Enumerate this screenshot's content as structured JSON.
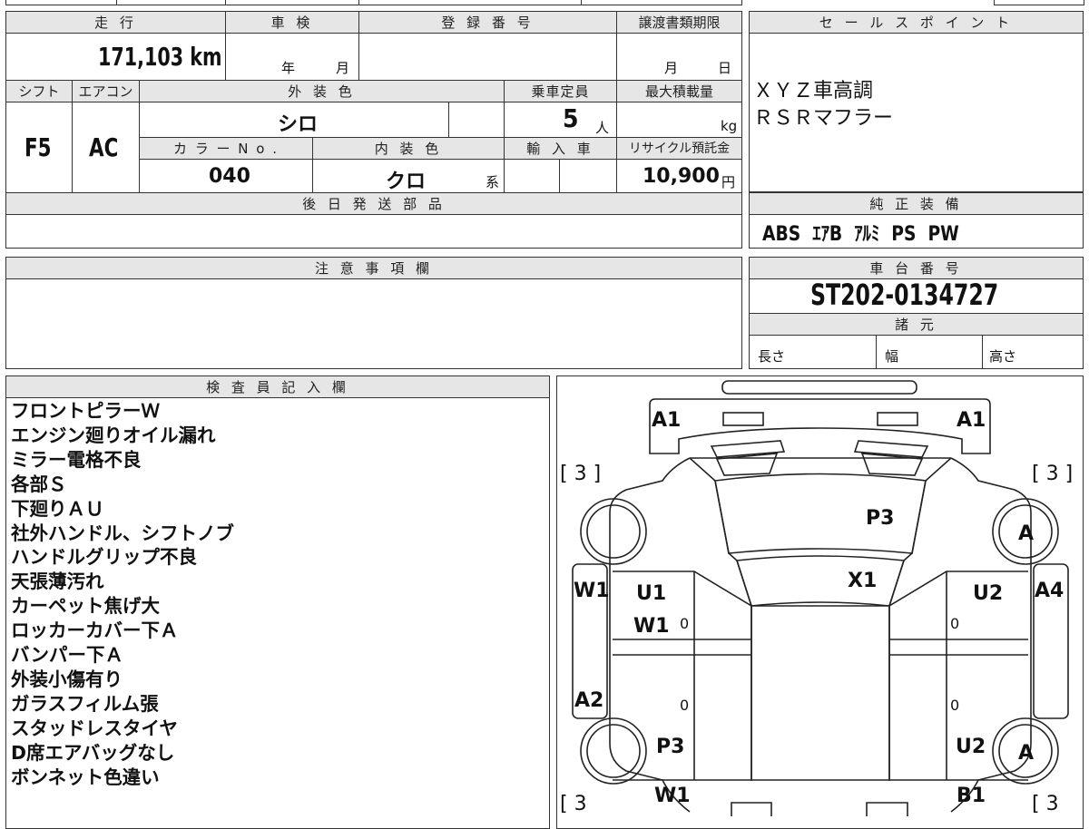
{
  "vehicle": {
    "mileage_label": "走 行",
    "mileage": "171,103 km",
    "inspection_label": "車 検",
    "inspection_year_unit": "年",
    "inspection_month_unit": "月",
    "registration_label": "登 録 番 号",
    "registration_value": "",
    "transfer_deadline_label": "譲渡書類期限",
    "transfer_month_unit": "月",
    "transfer_day_unit": "日",
    "shift_label": "シフト",
    "shift": "F5",
    "aircon_label": "エアコン",
    "aircon": "AC",
    "exterior_color_label": "外 装 色",
    "exterior_color": "シロ",
    "capacity_label": "乗車定員",
    "capacity": "5",
    "capacity_unit": "人",
    "max_load_label": "最大積載量",
    "max_load_unit": "kg",
    "color_no_label": "カ ラ ー N o .",
    "color_no": "040",
    "interior_color_label": "内 装 色",
    "interior_color": "クロ",
    "interior_color_suffix": "系",
    "import_label": "輸 入 車",
    "recycle_label": "リサイクル預託金",
    "recycle_fee": "10,900",
    "recycle_unit": "円",
    "later_parts_label": "後 日 発 送 部 品"
  },
  "sales_points": {
    "label": "セ ー ル ス ポ イ ン ト",
    "items": [
      "ＸＹＺ車高調",
      "ＲＳＲマフラー"
    ]
  },
  "standard_equipment": {
    "label": "純 正 装 備",
    "value": "ABS  ｴｱB  ｱﾙﾐ  PS  PW"
  },
  "caution": {
    "label": "注 意 事 項 欄"
  },
  "chassis": {
    "label": "車 台 番 号",
    "number": "ST202-0134727",
    "specs_label": "諸 元",
    "length_label": "長さ",
    "width_label": "幅",
    "height_label": "高さ"
  },
  "inspector_notes": {
    "label": "検 査 員 記 入 欄",
    "lines": [
      "フロントピラーＷ",
      "エンジン廻りオイル漏れ",
      "ミラー電格不良",
      "各部Ｓ",
      "下廻りＡＵ",
      "社外ハンドル、シフトノブ",
      "ハンドルグリップ不良",
      "天張薄汚れ",
      "カーペット焦げ大",
      "ロッカーカバー下Ａ",
      "バンパー下Ａ",
      "外装小傷有り",
      "ガラスフィルム張",
      "スタッドレスタイヤ",
      "D席エアバッグなし",
      "ボンネット色違い"
    ]
  },
  "diagram": {
    "a1_left": "A1",
    "a1_right": "A1",
    "tire_fl": "[ 3 ]",
    "tire_fr": "[ 3 ]",
    "tire_rl": "[ 3",
    "tire_rr": "[ 3",
    "p3_hood": "P3",
    "a_front_right": "A",
    "x1_windshield": "X1",
    "w1_left_pillar": "W1",
    "u1_front_left": "U1",
    "w1_front_left": "W1",
    "u2_front_right": "U2",
    "a4_right": "A4",
    "zero_1": "0",
    "zero_2": "0",
    "a2_left": "A2",
    "zero_3": "0",
    "zero_4": "0",
    "p3_rear_left": "P3",
    "u2_rear_right": "U2",
    "a_rear_right": "A",
    "w1_rear_left": "W1",
    "b1_rear_right": "B1"
  }
}
